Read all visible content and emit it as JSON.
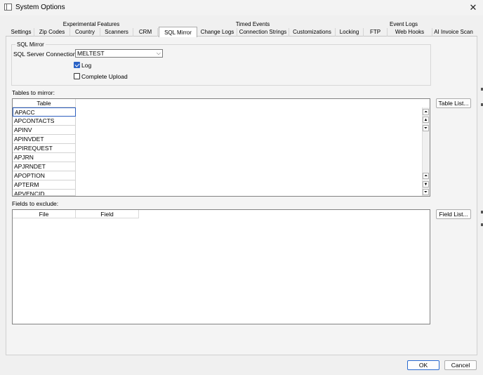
{
  "window": {
    "title": "System Options",
    "close_glyph": "✕"
  },
  "tabs_row1": [
    "Experimental Features",
    "Timed Events",
    "Event Logs"
  ],
  "tabs_row2": [
    "Settings",
    "Zip Codes",
    "Country",
    "Scanners",
    "CRM",
    "SQL Mirror",
    "Change Logs",
    "Connection Strings",
    "Customizations",
    "Locking",
    "FTP",
    "Web Hooks",
    "AI Invoice Scan"
  ],
  "active_tab": "SQL Mirror",
  "sql_mirror": {
    "group_label": "SQL Mirror",
    "connection_label": "SQL Server Connection ID:",
    "connection_value": "MELTEST",
    "log_label": "Log",
    "log_checked": true,
    "complete_upload_label": "Complete Upload",
    "complete_upload_checked": false
  },
  "tables": {
    "label": "Tables to mirror:",
    "column_header": "Table",
    "rows": [
      "APACC",
      "APCONTACTS",
      "APINV",
      "APINVDET",
      "APIREQUEST",
      "APJRN",
      "APJRNDET",
      "APOPTION",
      "APTERM",
      "APVENCID"
    ],
    "button_label": "Table List...",
    "scroll_buttons": [
      "⏶",
      "▲",
      "⏷",
      "⏶",
      "▼",
      "⏷"
    ]
  },
  "fields": {
    "label": "Fields to exclude:",
    "column_headers": [
      "File",
      "Field"
    ],
    "button_label": "Field List..."
  },
  "footer": {
    "ok_label": "OK",
    "cancel_label": "Cancel"
  }
}
